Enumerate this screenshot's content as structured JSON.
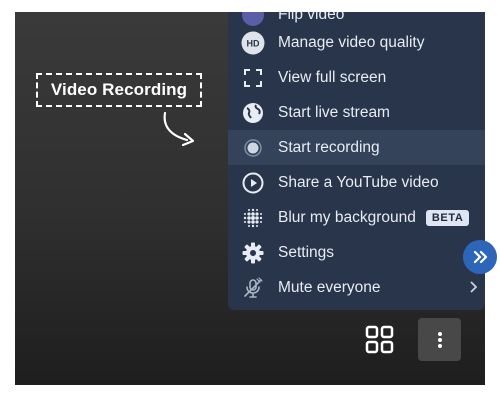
{
  "annotation": {
    "label": "Video Recording"
  },
  "menu": {
    "items": [
      {
        "label": "Flip video",
        "icon": "flip-video-icon"
      },
      {
        "label": "Manage video quality",
        "icon": "hd-icon",
        "icon_text": "HD"
      },
      {
        "label": "View full screen",
        "icon": "fullscreen-icon"
      },
      {
        "label": "Start live stream",
        "icon": "globe-icon"
      },
      {
        "label": "Start recording",
        "icon": "record-icon",
        "active": true
      },
      {
        "label": "Share a YouTube video",
        "icon": "play-circle-icon"
      },
      {
        "label": "Blur my background",
        "icon": "blur-icon",
        "badge": "BETA"
      },
      {
        "label": "Settings",
        "icon": "gear-icon"
      },
      {
        "label": "Mute everyone",
        "icon": "mic-off-icon"
      }
    ]
  },
  "side_button": {
    "icon": "double-chevron-right-icon"
  },
  "toolbar": {
    "grid_icon": "tile-view-icon",
    "more_icon": "more-vertical-icon"
  },
  "colors": {
    "menu_bg": "#28354a",
    "menu_active": "#34435a",
    "accent": "#2d66b8"
  }
}
